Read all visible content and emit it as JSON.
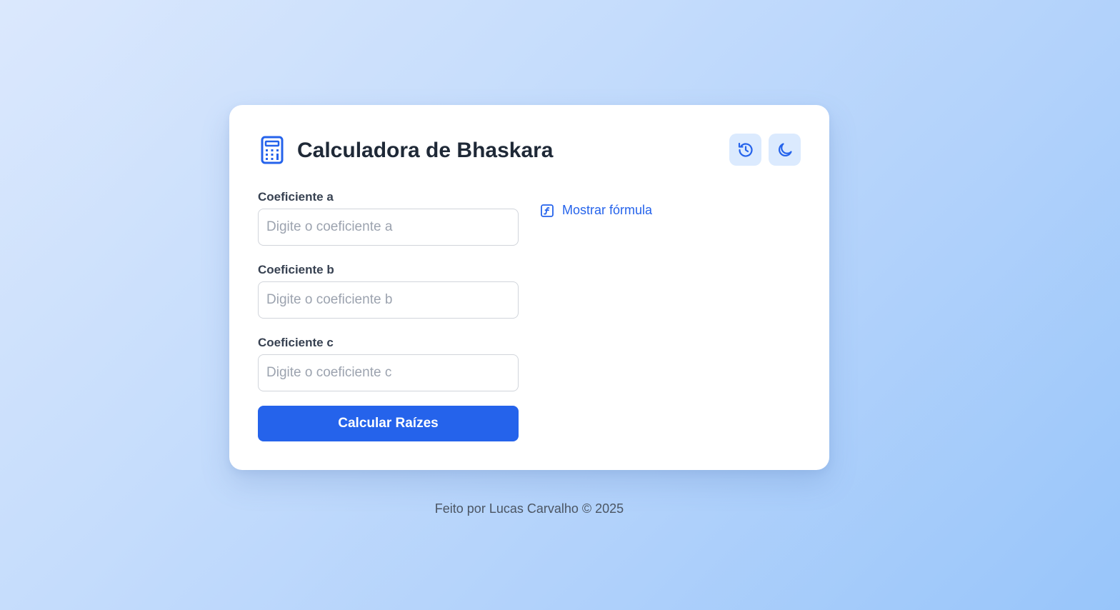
{
  "app": {
    "title": "Calculadora de Bhaskara",
    "icon": "calculator-icon",
    "accent_color": "#2563eb"
  },
  "header": {
    "history_button": {
      "icon": "history-icon"
    },
    "theme_button": {
      "icon": "moon-icon"
    }
  },
  "form": {
    "fields": [
      {
        "label": "Coeficiente a",
        "placeholder": "Digite o coeficiente a",
        "value": ""
      },
      {
        "label": "Coeficiente b",
        "placeholder": "Digite o coeficiente b",
        "value": ""
      },
      {
        "label": "Coeficiente c",
        "placeholder": "Digite o coeficiente c",
        "value": ""
      }
    ],
    "submit_label": "Calcular Raízes"
  },
  "formula": {
    "toggle_label": "Mostrar fórmula",
    "icon": "function-icon"
  },
  "footer": {
    "text": "Feito por Lucas Carvalho © 2025"
  }
}
